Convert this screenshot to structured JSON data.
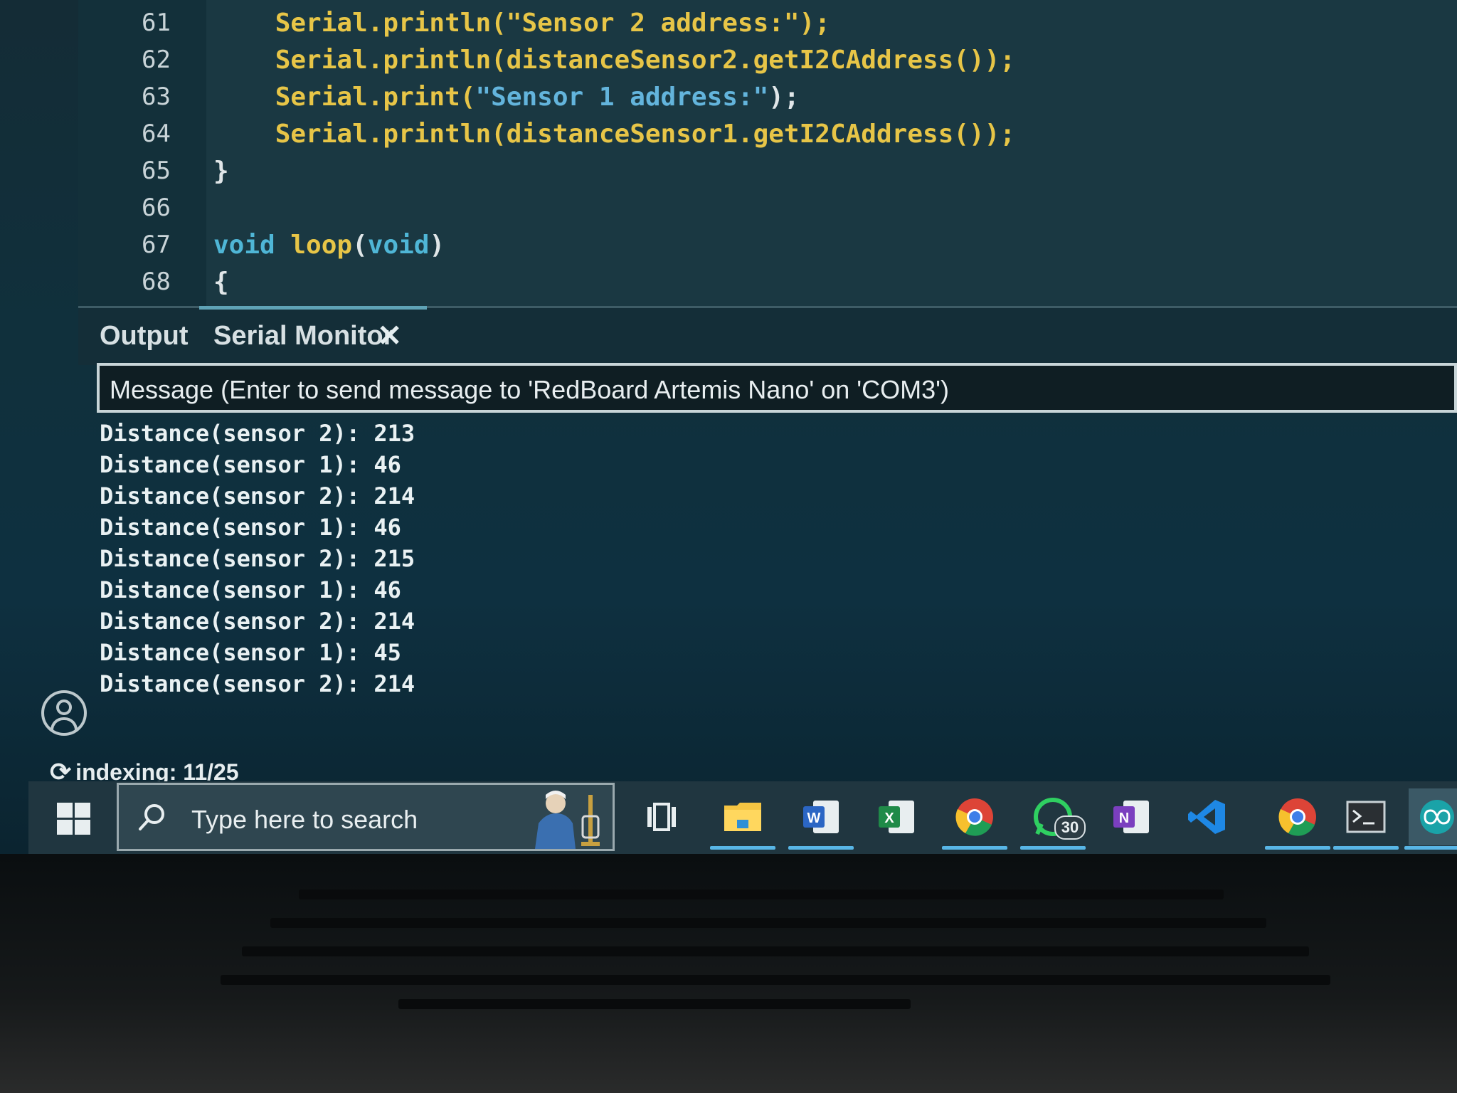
{
  "editor": {
    "lines": [
      {
        "num": "61",
        "code": [
          {
            "t": "    Serial.println(\"Sensor 2 address:\");",
            "c": "c-fn"
          }
        ]
      },
      {
        "num": "62",
        "code": [
          {
            "t": "    Serial.println(distanceSensor2.getI2CAddress());",
            "c": "c-fn"
          }
        ]
      },
      {
        "num": "63",
        "code": [
          {
            "t": "    Serial.print(",
            "c": "c-fn"
          },
          {
            "t": "\"Sensor 1 address:\"",
            "c": "c-str"
          },
          {
            "t": ");",
            "c": "c-pn"
          }
        ]
      },
      {
        "num": "64",
        "code": [
          {
            "t": "    Serial.println(distanceSensor1.getI2CAddress());",
            "c": "c-fn"
          }
        ]
      },
      {
        "num": "65",
        "code": [
          {
            "t": "}",
            "c": "c-pn"
          }
        ]
      },
      {
        "num": "66",
        "code": []
      },
      {
        "num": "67",
        "code": [
          {
            "t": "void ",
            "c": "c-kw"
          },
          {
            "t": "loop",
            "c": "c-fn"
          },
          {
            "t": "(",
            "c": "c-pn"
          },
          {
            "t": "void",
            "c": "c-kw"
          },
          {
            "t": ")",
            "c": "c-pn"
          }
        ]
      },
      {
        "num": "68",
        "code": [
          {
            "t": "{",
            "c": "c-pn"
          }
        ]
      }
    ]
  },
  "panel": {
    "tab_output": "Output",
    "tab_serial": "Serial Monitor",
    "close_glyph": "✕",
    "message_placeholder": "Message (Enter to send message to 'RedBoard Artemis Nano' on 'COM3')"
  },
  "serial_output": [
    "Distance(sensor 2): 213",
    "Distance(sensor 1): 46",
    "Distance(sensor 2): 214",
    "Distance(sensor 1): 46",
    "Distance(sensor 2): 215",
    "Distance(sensor 1): 46",
    "Distance(sensor 2): 214",
    "Distance(sensor 1): 45",
    "Distance(sensor 2): 214"
  ],
  "status": {
    "indexing": "indexing: 11/25"
  },
  "taskbar": {
    "search_placeholder": "Type here to search",
    "whatsapp_badge": "30",
    "apps": [
      "task-view-icon",
      "file-explorer-icon",
      "word-icon",
      "excel-icon",
      "chrome-icon",
      "whatsapp-icon",
      "onenote-icon",
      "vscode-icon",
      "chrome-profile-icon",
      "terminal-icon",
      "arduino-icon"
    ]
  }
}
